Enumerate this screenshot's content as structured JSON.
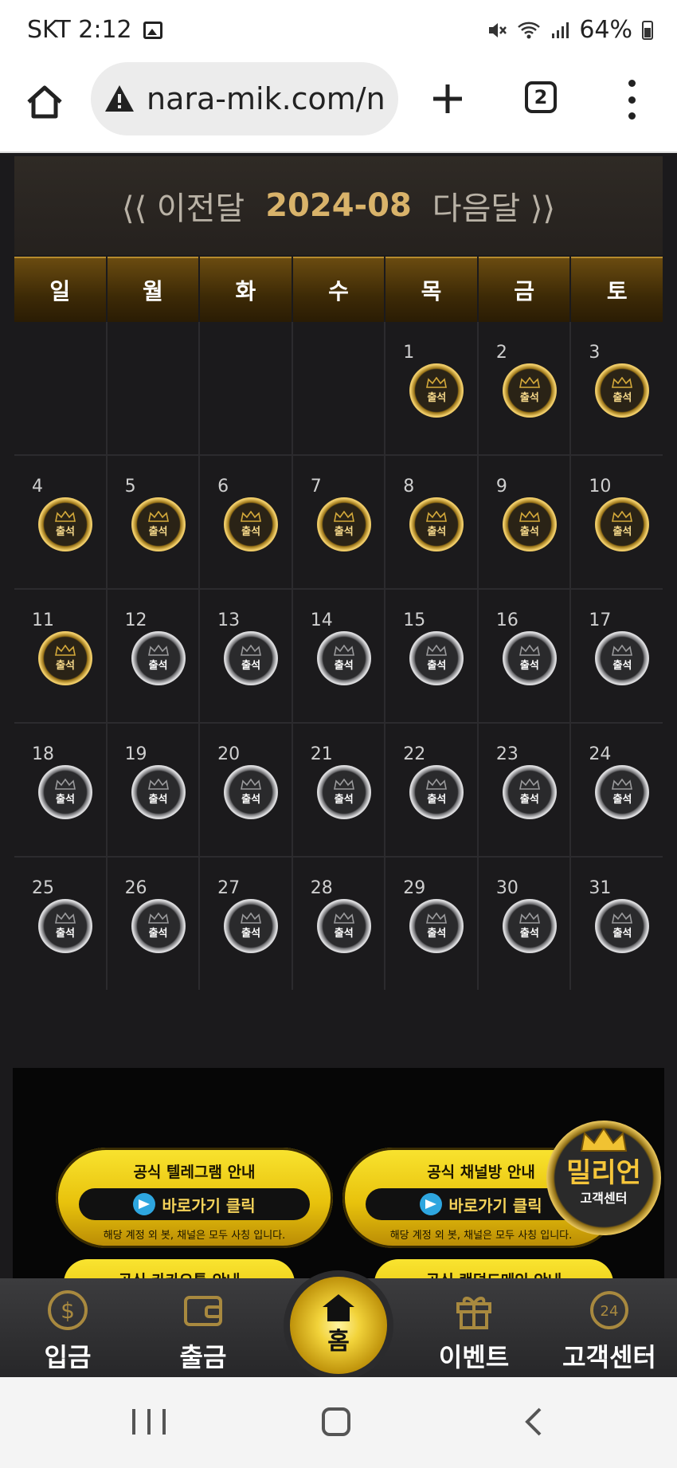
{
  "status_bar": {
    "carrier_time": "SKT 2:12",
    "battery": "64%"
  },
  "browser": {
    "url": "nara-mik.com/n",
    "tab_count": "2"
  },
  "calendar": {
    "prev_label": "⟨⟨ 이전달",
    "month": "2024-08",
    "next_label": "다음달 ⟩⟩",
    "weekdays": [
      "일",
      "월",
      "화",
      "수",
      "목",
      "금",
      "토"
    ],
    "leading_blank_days": 4,
    "days_in_month": 31,
    "attended_through_day": 11,
    "badge_label": "출석",
    "attended_color": "#d4a93a",
    "not_attended_color": "#9a9a9c"
  },
  "banner": {
    "telegram_title": "공식 텔레그램 안내",
    "telegram_link": "바로가기 클릭",
    "telegram_note": "해당 계정 외 봇, 채널은 모두 사칭 입니다.",
    "channel_title": "공식 채널방 안내",
    "channel_link": "바로가기 클릭",
    "channel_note": "해당 계정 외 봇, 채널은 모두 사칭 입니다.",
    "kakao_title": "공식 카카오톡 안내",
    "random_title": "공식 랜덤드메인 안내",
    "million_name": "밀리언",
    "million_sub": "고객센터"
  },
  "bottom_nav": {
    "deposit": "입금",
    "withdraw": "출금",
    "home": "홈",
    "event": "이벤트",
    "support": "고객센터"
  }
}
